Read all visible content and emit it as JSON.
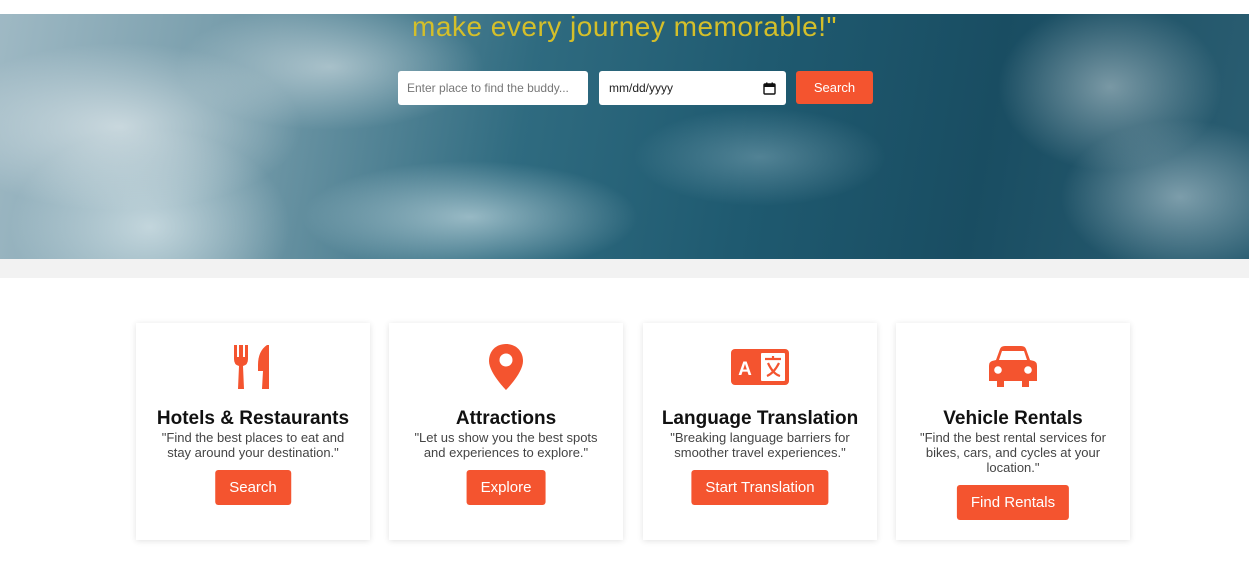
{
  "hero": {
    "tagline": "make every journey memorable!\"",
    "place_placeholder": "Enter place to find the buddy...",
    "date_value": "mm/dd/yyyy",
    "search_label": "Search"
  },
  "colors": {
    "accent": "#f4542f",
    "tagline": "#d4bf2a"
  },
  "cards": [
    {
      "icon": "utensils-icon",
      "title": "Hotels & Restaurants",
      "desc": "\"Find the best places to eat and stay around your destination.\"",
      "button": "Search"
    },
    {
      "icon": "map-pin-icon",
      "title": "Attractions",
      "desc": "\"Let us show you the best spots and experiences to explore.\"",
      "button": "Explore"
    },
    {
      "icon": "translate-icon",
      "title": "Language Translation",
      "desc": "\"Breaking language barriers for smoother travel experiences.\"",
      "button": "Start Translation"
    },
    {
      "icon": "car-icon",
      "title": "Vehicle Rentals",
      "desc": "\"Find the best rental services for bikes, cars, and cycles at your location.\"",
      "button": "Find Rentals"
    }
  ]
}
